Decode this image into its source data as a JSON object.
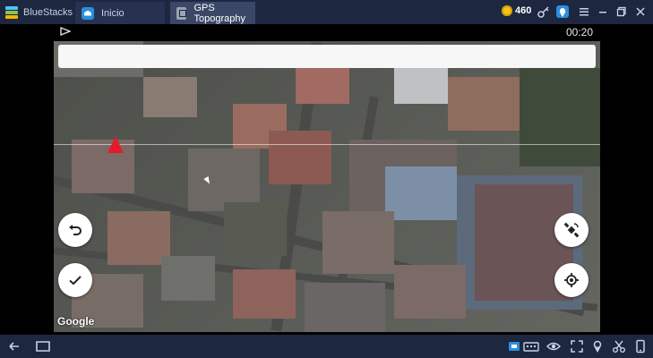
{
  "window": {
    "app_name": "BlueStacks",
    "tabs": [
      {
        "label": "Inicio",
        "icon": "home-icon"
      },
      {
        "label": "GPS Topography",
        "icon": "gps-app-icon"
      }
    ],
    "coins": "460"
  },
  "android": {
    "status_time": "00:20"
  },
  "map": {
    "attribution": "Google",
    "marker_color": "#e21d2b"
  },
  "colors": {
    "chrome": "#1d2740",
    "active_tab": "#3a4767",
    "accent": "#2b8de0"
  }
}
